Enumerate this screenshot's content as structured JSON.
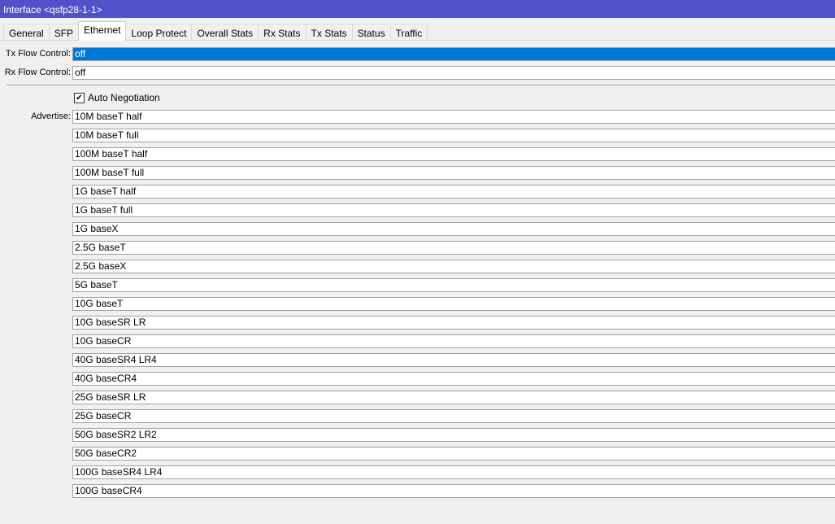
{
  "window": {
    "title": "Interface <qsfp28-1-1>"
  },
  "tabs": [
    "General",
    "SFP",
    "Ethernet",
    "Loop Protect",
    "Overall Stats",
    "Rx Stats",
    "Tx Stats",
    "Status",
    "Traffic"
  ],
  "form": {
    "tx_flow_label": "Tx Flow Control:",
    "tx_flow_value": "off",
    "rx_flow_label": "Rx Flow Control:",
    "rx_flow_value": "off",
    "auto_neg_label": "Auto Negotiation",
    "auto_neg_checked": true,
    "check_glyph": "✔",
    "advertise_label": "Advertise:",
    "advertise": [
      "10M baseT half",
      "10M baseT full",
      "100M baseT half",
      "100M baseT full",
      "1G baseT half",
      "1G baseT full",
      "1G baseX",
      "2.5G baseT",
      "2.5G baseX",
      "5G baseT",
      "10G baseT",
      "10G baseSR LR",
      "10G baseCR",
      "40G baseSR4 LR4",
      "40G baseCR4",
      "25G baseSR LR",
      "25G baseCR",
      "50G baseSR2 LR2",
      "50G baseCR2",
      "100G baseSR4 LR4",
      "100G baseCR4"
    ]
  }
}
